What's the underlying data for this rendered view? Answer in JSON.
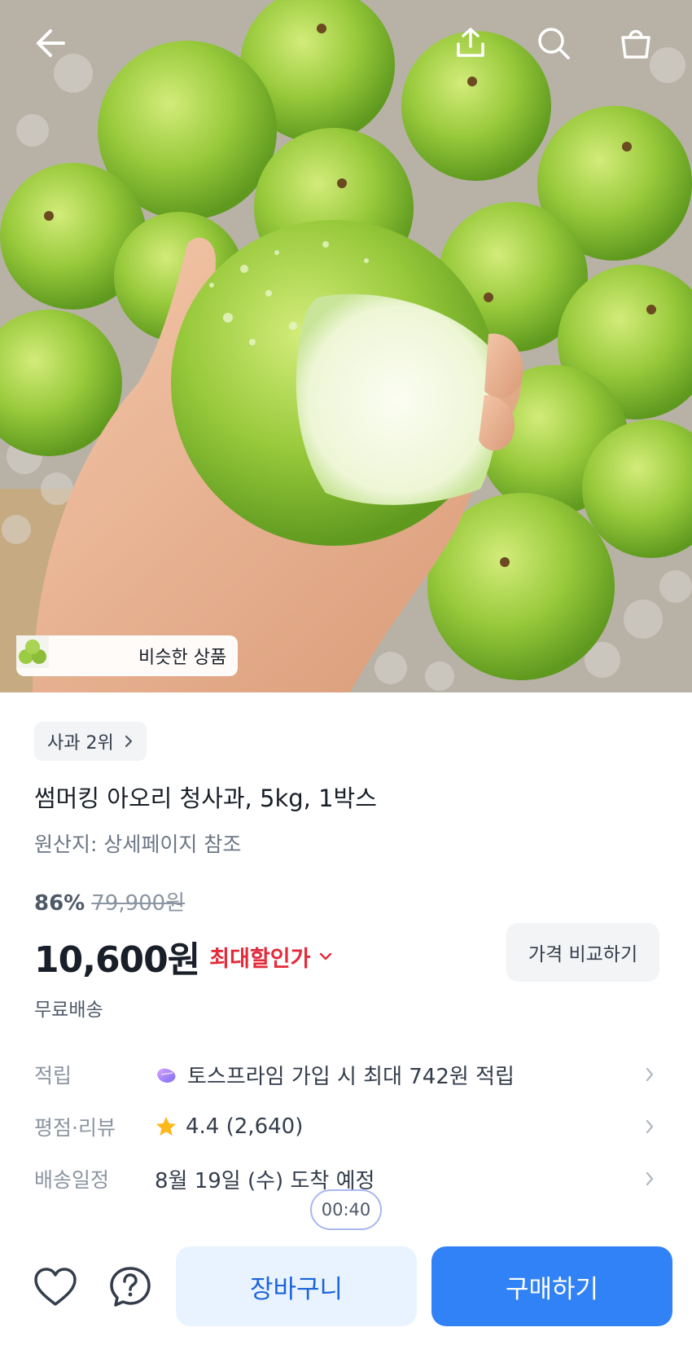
{
  "header": {
    "back_icon": "arrow-left-icon",
    "share_icon": "share-icon",
    "search_icon": "search-icon",
    "bag_icon": "shopping-bag-icon"
  },
  "hero": {
    "similar_label": "비슷한 상품"
  },
  "product": {
    "rank_label": "사과 2위",
    "title": "썸머킹 아오리 청사과, 5kg, 1박스",
    "origin": "원산지: 상세페이지 참조",
    "discount_percent": "86%",
    "original_price": "79,900원",
    "price": "10,600원",
    "max_discount_label": "최대할인가",
    "compare_label": "가격 비교하기",
    "shipping": "무료배송"
  },
  "details": {
    "points_label": "적립",
    "points_value": "토스프라임 가입 시 최대 742원 적립",
    "rating_label": "평점·리뷰",
    "rating_value": "4.4 (2,640)",
    "delivery_label": "배송일정",
    "delivery_value": "8월 19일 (수) 도착 예정"
  },
  "timer": "00:40",
  "actions": {
    "cart_label": "장바구니",
    "buy_label": "구매하기",
    "heart_icon": "heart-icon",
    "help_icon": "question-icon"
  },
  "colors": {
    "primary": "#3182f6",
    "primary_light": "#e8f3ff",
    "discount_red": "#e42939",
    "star": "#ffb81c"
  }
}
